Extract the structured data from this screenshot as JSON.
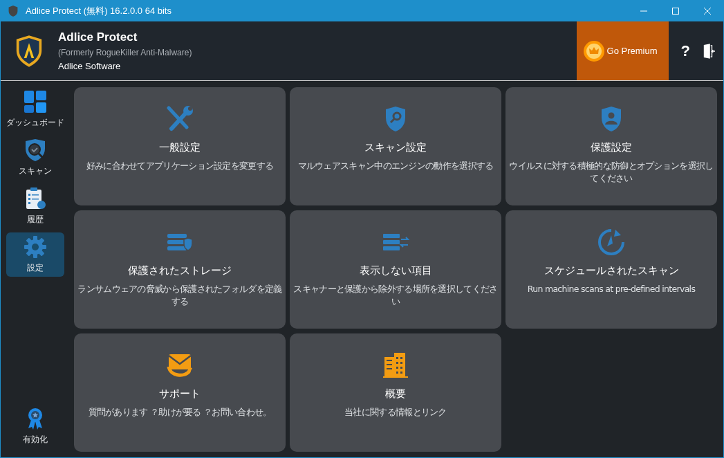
{
  "window": {
    "title": "Adlice Protect (無料) 16.2.0.0 64 bits"
  },
  "header": {
    "product": "Adlice Protect",
    "subtitle": "(Formerly RogueKiller Anti-Malware)",
    "company": "Adlice Software",
    "premium_button": "Go Premium",
    "help_button": "?"
  },
  "sidebar": {
    "items": [
      {
        "label": "ダッシュボード",
        "kind": "dashboard",
        "selected": false
      },
      {
        "label": "スキャン",
        "kind": "scan",
        "selected": false
      },
      {
        "label": "履歴",
        "kind": "history",
        "selected": false
      },
      {
        "label": "設定",
        "kind": "settings",
        "selected": true
      }
    ],
    "footer": {
      "label": "有効化",
      "kind": "activate",
      "selected": false
    }
  },
  "tiles": [
    {
      "kind": "tools",
      "title": "一般設定",
      "description": "好みに合わせてアプリケーション設定を変更する"
    },
    {
      "kind": "shield-search",
      "title": "スキャン設定",
      "description": "マルウェアスキャン中のエンジンの動作を選択する"
    },
    {
      "kind": "shield-user",
      "title": "保護設定",
      "description": "ウイルスに対する積極的な防御とオプションを選択してください"
    },
    {
      "kind": "storage",
      "title": "保護されたストレージ",
      "description": "ランサムウェアの脅威から保護されたフォルダを定義する"
    },
    {
      "kind": "exclusions",
      "title": "表示しない項目",
      "description": "スキャナーと保護から除外する場所を選択してください"
    },
    {
      "kind": "schedule",
      "title": "スケジュールされたスキャン",
      "description": "Run machine scans at pre-defined intervals"
    },
    {
      "kind": "support",
      "title": "サポート",
      "description": "質問があります ？助けが要る ？お問い合わせ。"
    },
    {
      "kind": "about",
      "title": "概要",
      "description": "当社に関する情報とリンク"
    }
  ]
}
